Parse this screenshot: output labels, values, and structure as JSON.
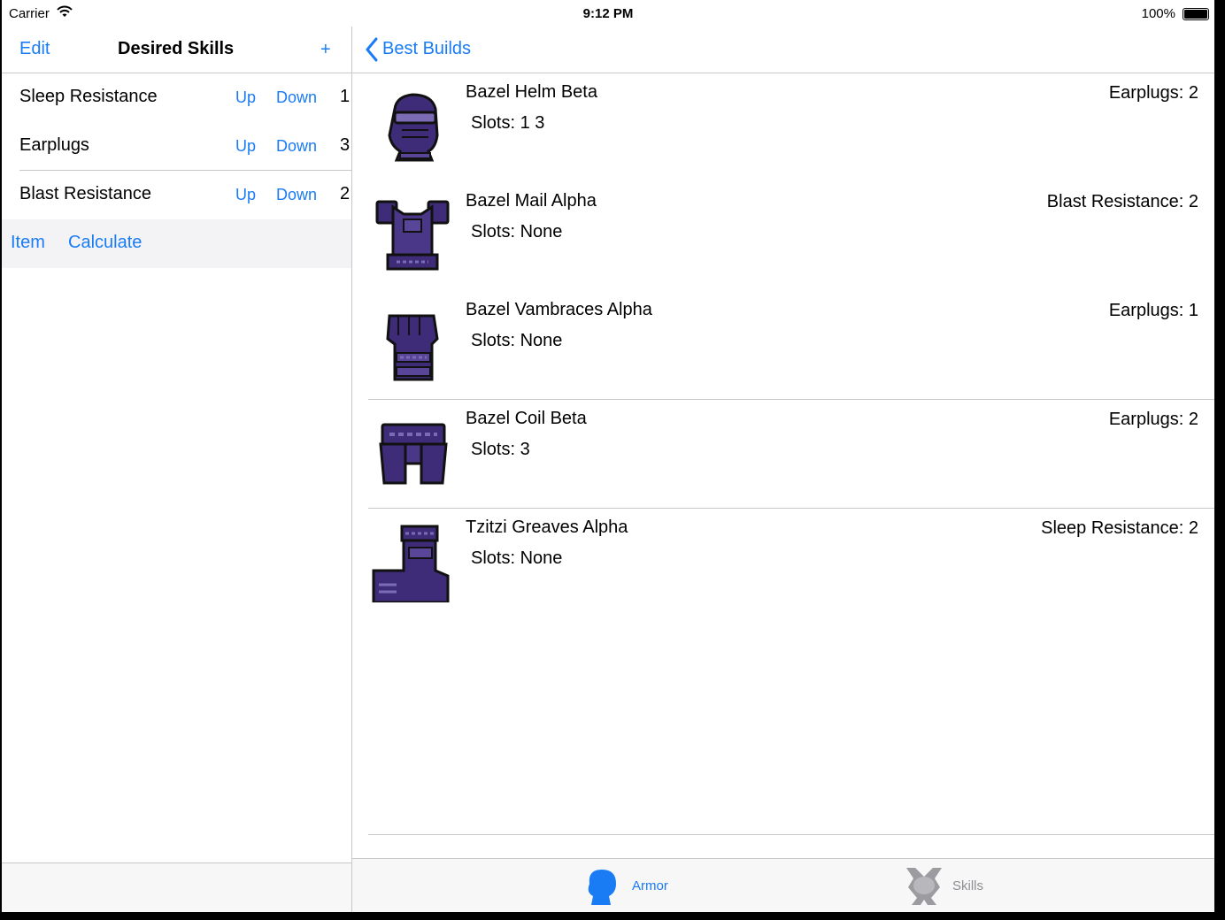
{
  "status_bar": {
    "carrier": "Carrier",
    "time": "9:12 PM",
    "battery": "100%"
  },
  "master": {
    "nav": {
      "edit": "Edit",
      "title": "Desired Skills",
      "add": "+"
    },
    "skills": [
      {
        "name": "Sleep Resistance",
        "up": "Up",
        "down": "Down",
        "level": "1"
      },
      {
        "name": "Earplugs",
        "up": "Up",
        "down": "Down",
        "level": "3"
      },
      {
        "name": "Blast Resistance",
        "up": "Up",
        "down": "Down",
        "level": "2"
      }
    ],
    "actions": {
      "item": "Item",
      "calculate": "Calculate"
    }
  },
  "detail": {
    "nav": {
      "back": "Best Builds"
    },
    "builds": [
      {
        "name": "Bazel Helm Beta",
        "slots": "Slots: 1 3",
        "skill": "Earplugs: 2",
        "icon": "helm-icon"
      },
      {
        "name": "Bazel Mail Alpha",
        "slots": "Slots: None",
        "skill": "Blast Resistance: 2",
        "icon": "chest-armor-icon"
      },
      {
        "name": "Bazel Vambraces Alpha",
        "slots": "Slots: None",
        "skill": "Earplugs: 1",
        "icon": "gauntlet-icon"
      },
      {
        "name": "Bazel Coil Beta",
        "slots": "Slots: 3",
        "skill": "Earplugs: 2",
        "icon": "waist-armor-icon"
      },
      {
        "name": "Tzitzi Greaves Alpha",
        "slots": "Slots: None",
        "skill": "Sleep Resistance: 2",
        "icon": "greaves-icon"
      }
    ]
  },
  "tabbar": {
    "tabs": [
      {
        "label": "Armor",
        "icon": "armor-head-icon",
        "selected": true
      },
      {
        "label": "Skills",
        "icon": "skills-icon",
        "selected": false
      }
    ]
  },
  "colors": {
    "accent": "#1a7cf5",
    "armor_purple": "#3f2c78",
    "separator": "#c8c8cc"
  }
}
